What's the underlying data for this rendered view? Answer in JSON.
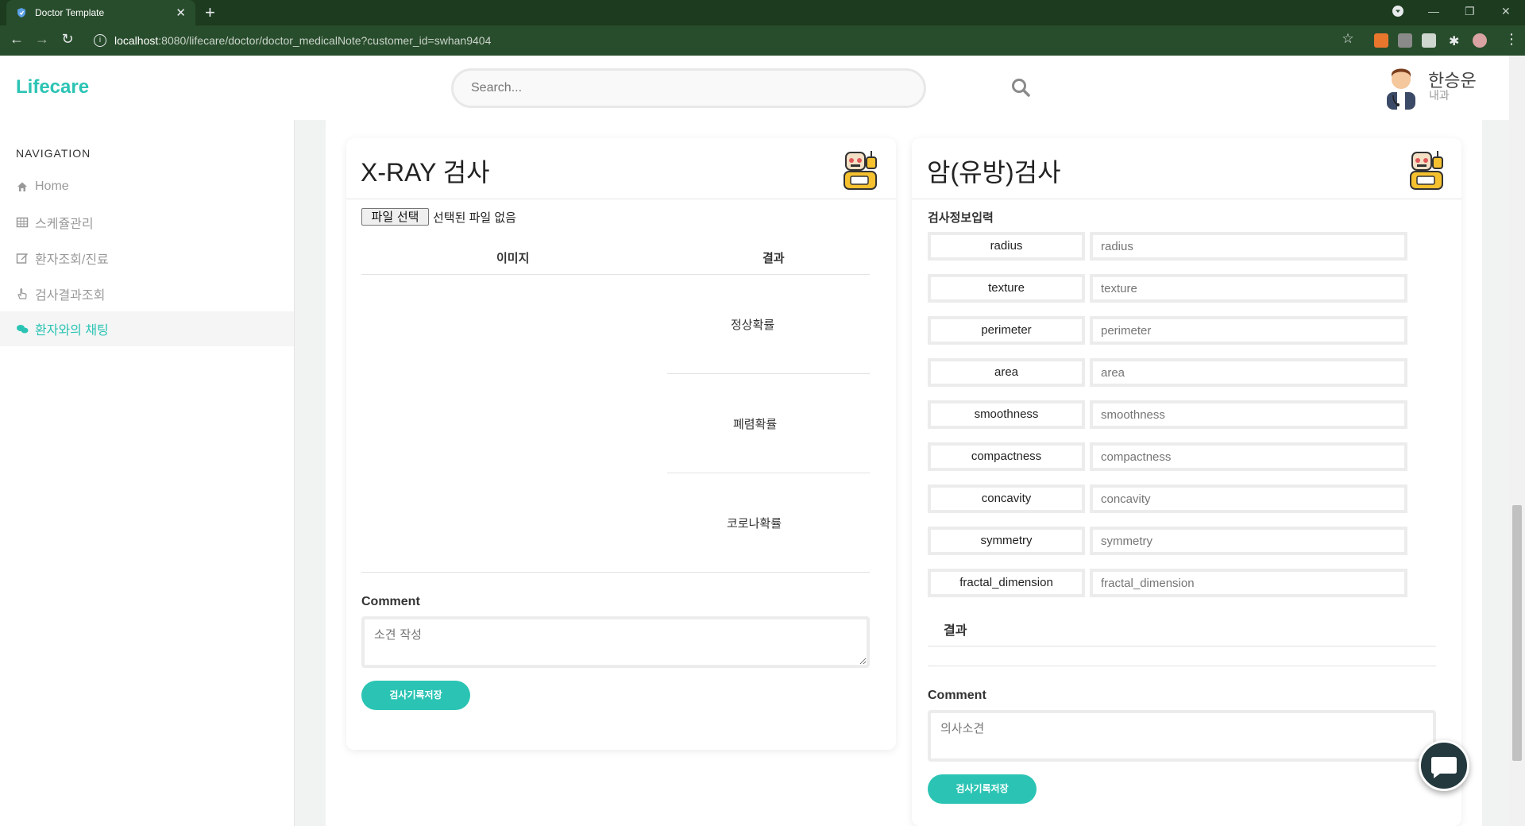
{
  "browser": {
    "tab_title": "Doctor Template",
    "url_host": "localhost",
    "url_path": ":8080/lifecare/doctor/doctor_medicalNote?customer_id=swhan9404"
  },
  "header": {
    "logo": "Lifecare",
    "search_placeholder": "Search...",
    "doctor_name": "한승운",
    "doctor_dept": "내과"
  },
  "sidebar": {
    "title": "NAVIGATION",
    "items": [
      {
        "label": "Home",
        "icon": "home-icon"
      },
      {
        "label": "스케쥴관리",
        "icon": "table-icon"
      },
      {
        "label": "환자조회/진료",
        "icon": "edit-icon"
      },
      {
        "label": "검사결과조회",
        "icon": "hand-pointer-icon"
      },
      {
        "label": "환자와의 채팅",
        "icon": "chat-icon",
        "active": true
      }
    ]
  },
  "xray": {
    "title": "X-RAY 검사",
    "file_button": "파일 선택",
    "file_status": "선택된 파일 없음",
    "col_image": "이미지",
    "col_result": "결과",
    "probs": [
      "정상확률",
      "폐렴확률",
      "코로나확률"
    ],
    "comment_label": "Comment",
    "comment_placeholder": "소견 작성",
    "save_button": "검사기록저장"
  },
  "cancer": {
    "title": "암(유방)검사",
    "section_label": "검사정보입력",
    "fields": [
      {
        "name": "radius",
        "placeholder": "radius"
      },
      {
        "name": "texture",
        "placeholder": "texture"
      },
      {
        "name": "perimeter",
        "placeholder": "perimeter"
      },
      {
        "name": "area",
        "placeholder": "area"
      },
      {
        "name": "smoothness",
        "placeholder": "smoothness"
      },
      {
        "name": "compactness",
        "placeholder": "compactness"
      },
      {
        "name": "concavity",
        "placeholder": "concavity"
      },
      {
        "name": "symmetry",
        "placeholder": "symmetry"
      },
      {
        "name": "fractal_dimension",
        "placeholder": "fractal_dimension"
      }
    ],
    "result_label": "결과",
    "comment_label": "Comment",
    "comment_placeholder": "의사소견",
    "save_button": "검사기록저장"
  },
  "colors": {
    "accent": "#2bc4b4",
    "chrome": "#284d2c"
  }
}
